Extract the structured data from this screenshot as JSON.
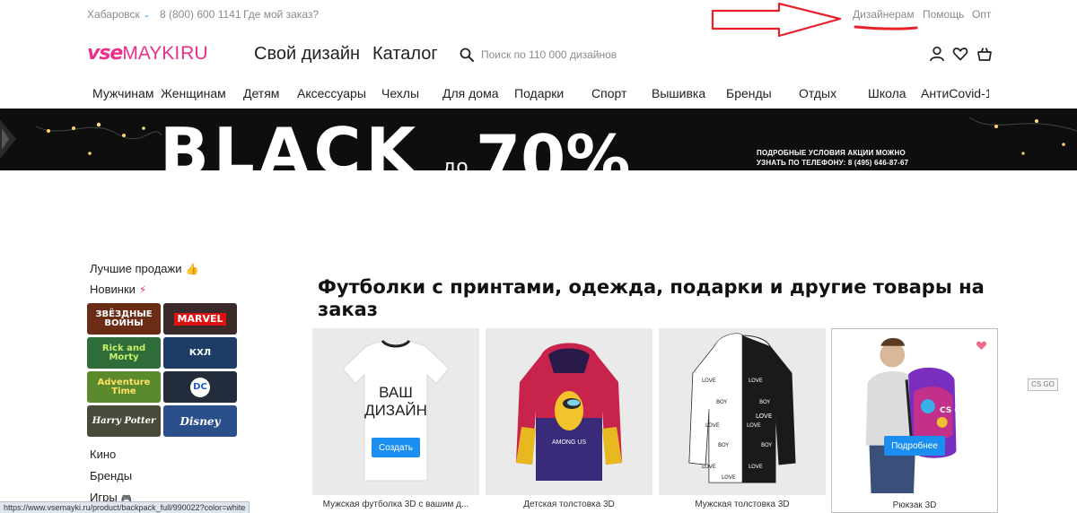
{
  "topbar": {
    "city": "Хабаровск",
    "phone": "8 (800) 600 1141",
    "order": "Где мой заказ?",
    "designers": "Дизайнерам",
    "help": "Помощь",
    "opt": "Опт"
  },
  "header": {
    "logo_vse": "vse",
    "logo_mayki": "MAYKI",
    "logo_ru": "RU",
    "nav_design": "Свой дизайн",
    "nav_catalog": "Каталог",
    "search_placeholder": "Поиск по 110 000 дизайнов"
  },
  "categories": [
    "Мужчинам",
    "Женщинам",
    "Детям",
    "Аксессуары",
    "Чехлы",
    "Для дома",
    "Подарки",
    "Спорт",
    "Вышивка",
    "Бренды",
    "Отдых",
    "Школа",
    "АнтиCovid-1"
  ],
  "banner": {
    "big_text": "BLACK",
    "do_text": "до",
    "pct_text": "70%",
    "note_line1": "ПОДРОБНЫЕ УСЛОВИЯ АКЦИИ МОЖНО",
    "note_line2": "УЗНАТЬ ПО ТЕЛЕФОНУ: 8 (495) 646-87-67"
  },
  "sidebar": {
    "best": "Лучшие продажи",
    "new": "Новинки",
    "kino": "Кино",
    "brands": "Бренды",
    "games": "Игры",
    "tiles": [
      {
        "label": "ЗВЁЗДНЫЕ ВОЙНЫ",
        "bg": "#6b2c16"
      },
      {
        "label": "MARVEL",
        "bg": "#3a2a2a"
      },
      {
        "label": "Rick and Morty",
        "bg": "#2f6e3a"
      },
      {
        "label": "КХЛ",
        "bg": "#1d3c66"
      },
      {
        "label": "Adventure Time",
        "bg": "#5a8a2c"
      },
      {
        "label": "DC",
        "bg": "#222c3a"
      },
      {
        "label": "Harry Potter",
        "bg": "#4a4a3a"
      },
      {
        "label": "Disney",
        "bg": "#2b4f8a"
      }
    ]
  },
  "main": {
    "title": "Футболки с принтами, одежда, подарки и другие товары на заказ",
    "cards": [
      {
        "caption": "Мужская футболка 3D с вашим д...",
        "cta": "Создать",
        "print_line1": "ВАШ",
        "print_line2": "ДИЗАЙН"
      },
      {
        "caption": "Детская толстовка 3D",
        "print_text": "AMONG US"
      },
      {
        "caption": "Мужская толстовка 3D",
        "print_text": "LOVE"
      },
      {
        "caption": "Рюкзак 3D",
        "cta": "Подробнее",
        "print_text": "CS GO"
      }
    ]
  },
  "csgo_tag": "CS GO",
  "statusbar": "https://www.vsemayki.ru/product/backpack_full/990022?color=white",
  "colors": {
    "brand": "#e8318a",
    "cta": "#1a8ff0",
    "annotation": "#e8202a"
  }
}
